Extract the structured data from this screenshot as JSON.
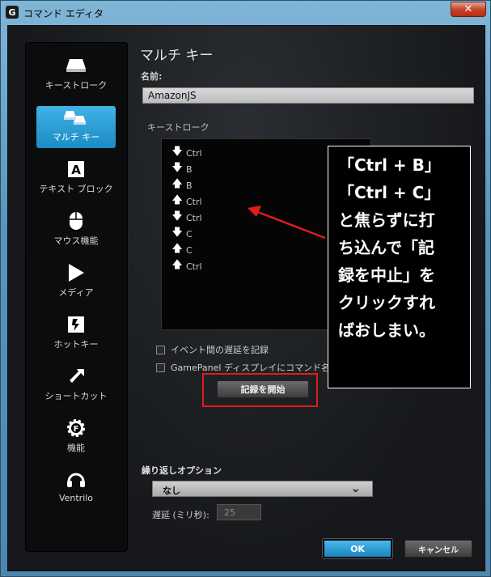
{
  "window": {
    "title": "コマンド エディタ",
    "icon_letter": "G",
    "close_glyph": "✕"
  },
  "sidebar": {
    "items": [
      {
        "label": "キーストローク",
        "icon": "keycap-icon",
        "active": false
      },
      {
        "label": "マルチ キー",
        "icon": "multi-keycap-icon",
        "active": true
      },
      {
        "label": "テキスト ブロック",
        "icon": "text-block-icon",
        "active": false
      },
      {
        "label": "マウス機能",
        "icon": "mouse-icon",
        "active": false
      },
      {
        "label": "メディア",
        "icon": "play-icon",
        "active": false
      },
      {
        "label": "ホットキー",
        "icon": "hotkey-icon",
        "active": false
      },
      {
        "label": "ショートカット",
        "icon": "shortcut-arrow-icon",
        "active": false
      },
      {
        "label": "機能",
        "icon": "function-gear-icon",
        "active": false
      },
      {
        "label": "Ventrilo",
        "icon": "headset-icon",
        "active": false
      }
    ]
  },
  "main": {
    "title": "マルチ キー",
    "name_label": "名前:",
    "name_value": "AmazonJS",
    "keystroke_label": "キーストローク",
    "keystrokes": [
      {
        "dir": "down",
        "key": "Ctrl"
      },
      {
        "dir": "down",
        "key": "B"
      },
      {
        "dir": "up",
        "key": "B"
      },
      {
        "dir": "up",
        "key": "Ctrl"
      },
      {
        "dir": "down",
        "key": "Ctrl"
      },
      {
        "dir": "down",
        "key": "C"
      },
      {
        "dir": "up",
        "key": "C"
      },
      {
        "dir": "up",
        "key": "Ctrl"
      }
    ],
    "checkbox_delay": "イベント間の遅延を記録",
    "checkbox_gamepanel": "GamePanel ディスプレイにコマンド名を",
    "record_button": "記録を開始",
    "repeat_label": "繰り返しオプション",
    "repeat_value": "なし",
    "delay_label": "遅延 (ミリ秒):",
    "delay_value": "25",
    "ok_button": "OK",
    "cancel_button": "キャンセル"
  },
  "callout": {
    "lines": [
      "「Ctrl + B」",
      "「Ctrl + C」",
      "と焦らずに打",
      "ち込んで「記",
      "録を中止」を",
      "クリックすれ",
      "ばおしまい。"
    ]
  },
  "colors": {
    "accent": "#2aa0d8",
    "annotation": "#e31b1b"
  }
}
